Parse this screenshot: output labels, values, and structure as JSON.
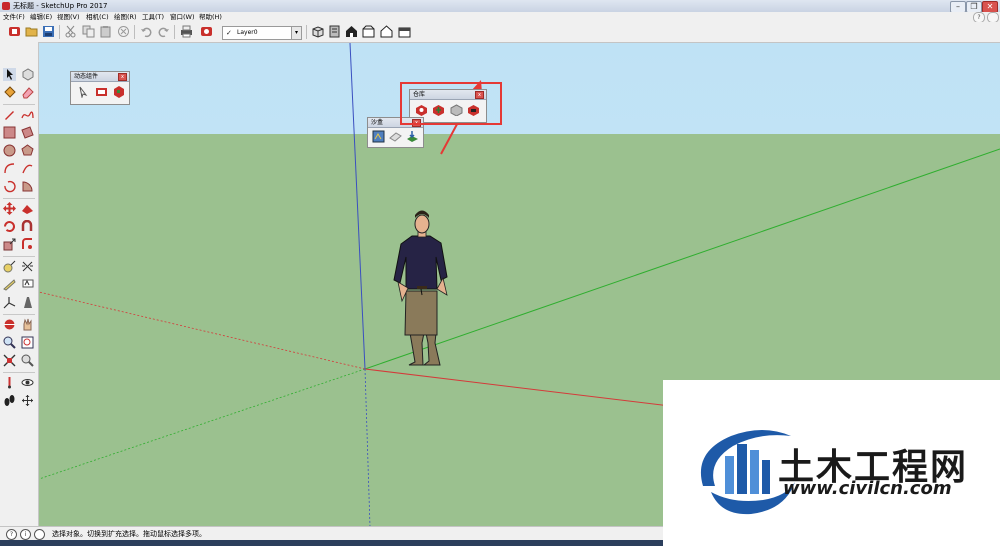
{
  "window": {
    "title": "无标题 - SketchUp Pro 2017",
    "minimize": "–",
    "restore": "❐",
    "close": "✕"
  },
  "menu": {
    "items": [
      "文件(F)",
      "编辑(E)",
      "视图(V)",
      "相机(C)",
      "绘图(R)",
      "工具(T)",
      "窗口(W)",
      "帮助(H)"
    ],
    "help_icon": "?"
  },
  "toolbar": {
    "layer_check": "✓",
    "layer_name": "Layer0",
    "layer_arrow": "▾",
    "icons": [
      "get-started-icon",
      "open-icon",
      "save-icon",
      "cut-icon",
      "copy-icon",
      "paste-icon",
      "erase-icon",
      "undo-icon",
      "redo-icon",
      "print-icon",
      "model-info-icon",
      "iso-view-icon",
      "top-view-icon",
      "front-view-icon",
      "right-view-icon",
      "back-view-icon",
      "left-view-icon"
    ]
  },
  "panels": {
    "dynamic_components": {
      "title": "动态组件",
      "close": "x"
    },
    "warehouse": {
      "title": "仓库",
      "close": "x"
    },
    "sandbox": {
      "title": "沙盒",
      "close": "x"
    }
  },
  "status": {
    "text": "选择对象。切换到扩充选择。拖动鼠标选择多项。",
    "icon1": "?",
    "icon2": "i"
  },
  "watermark": {
    "brand": "土木工程网",
    "url": "www.civilcn.com"
  },
  "colors": {
    "sky": "#c3e4f6",
    "ground": "#9bc18f",
    "axis_red": "#d43a3a",
    "axis_green": "#2fae2f",
    "axis_blue": "#3a4fc0",
    "highlight": "#e53935",
    "brand_blue": "#1e5aa8",
    "brand_text": "#1a1a1a"
  }
}
